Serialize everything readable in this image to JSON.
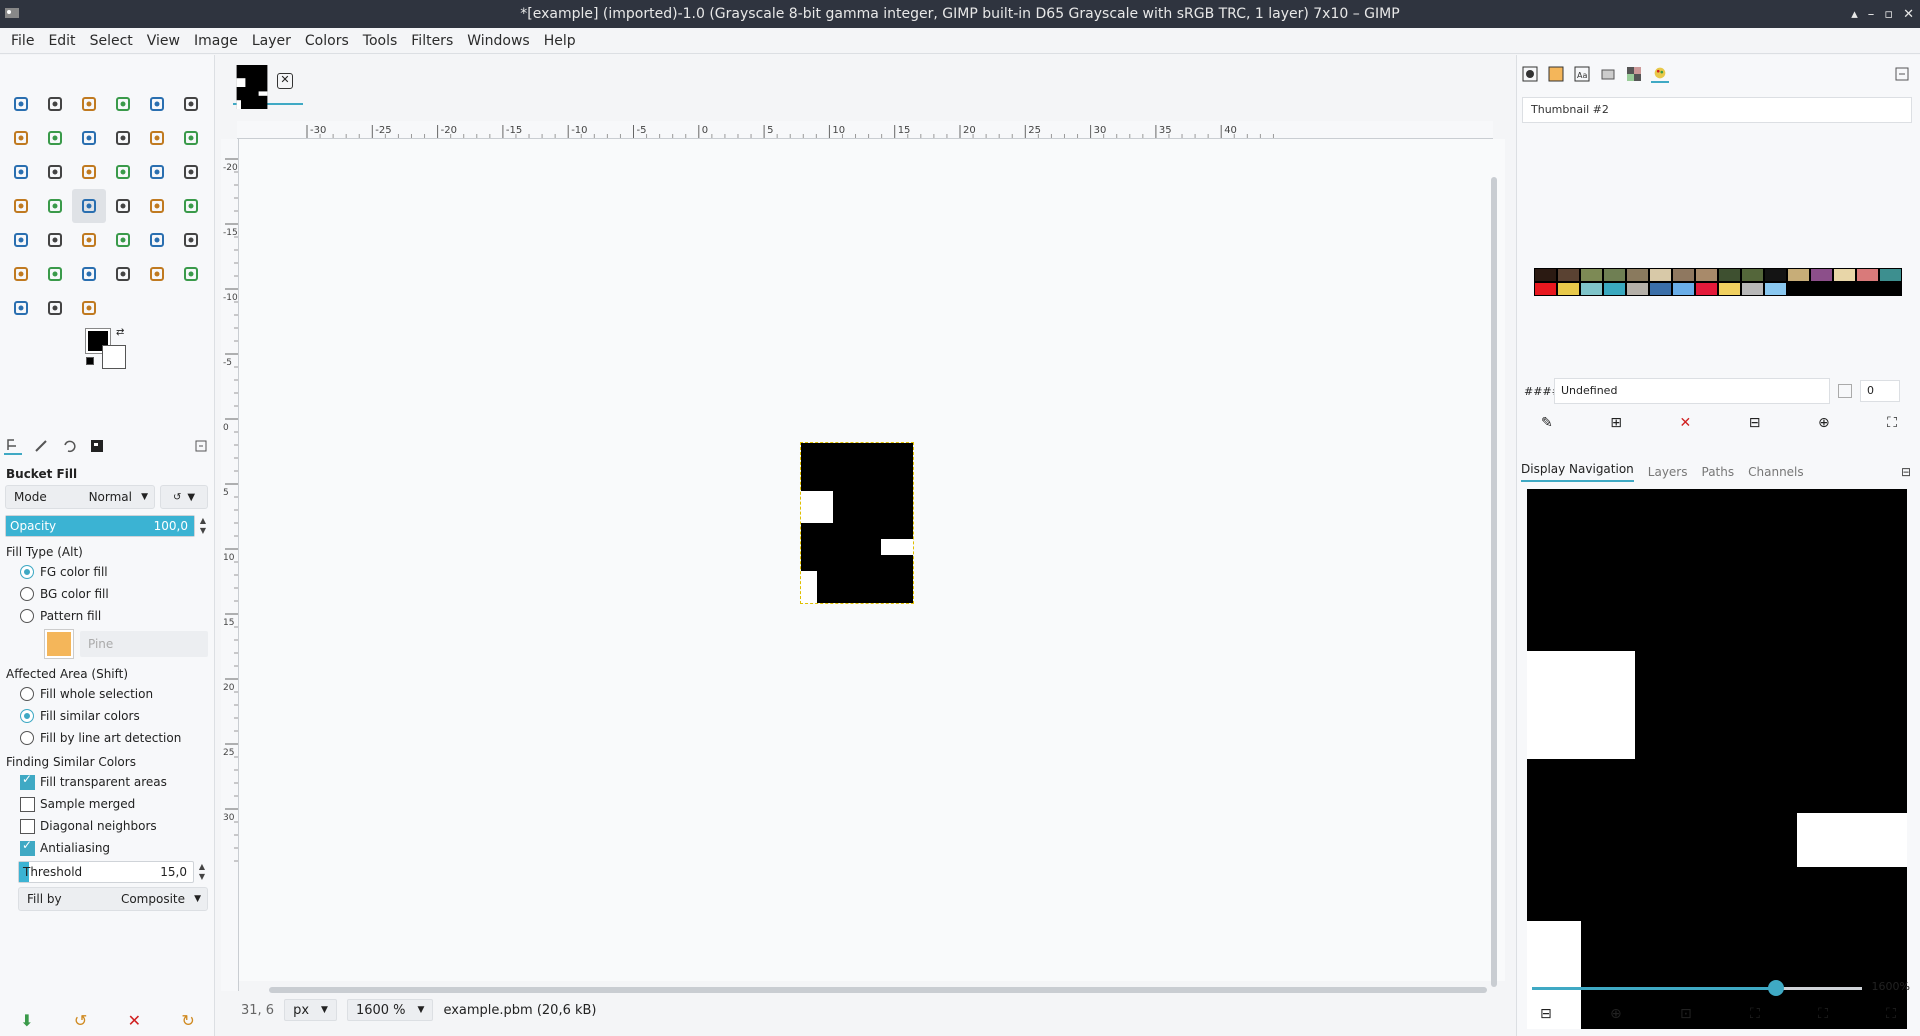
{
  "window": {
    "title": "*[example] (imported)-1.0 (Grayscale 8-bit gamma integer, GIMP built-in D65 Grayscale with sRGB TRC, 1 layer) 7x10 – GIMP",
    "controls": [
      "▴",
      "–",
      "▫",
      "✕"
    ]
  },
  "menu": [
    "File",
    "Edit",
    "Select",
    "View",
    "Image",
    "Layer",
    "Colors",
    "Tools",
    "Filters",
    "Windows",
    "Help"
  ],
  "tools": [
    "move-tool",
    "align-tool",
    "rect-select-tool",
    "ellipse-select-tool",
    "free-select-tool",
    "scissors-select-tool",
    "foreground-select-tool",
    "fuzzy-select-tool",
    "color-select-tool",
    "crop-tool",
    "unified-transform-tool",
    "warp-tool",
    "rotate-tool",
    "scale-tool",
    "shear-tool",
    "perspective-tool",
    "3d-transform-tool",
    "handle-transform-tool",
    "flip-tool",
    "cage-tool",
    "bucket-fill-tool",
    "gradient-tool",
    "paintbrush-tool",
    "pencil-tool",
    "airbrush-tool",
    "ink-tool",
    "mypaint-brush-tool",
    "eraser-tool",
    "clone-tool",
    "heal-tool",
    "smudge-tool",
    "convolve-tool",
    "dodge-burn-tool",
    "text-tool-alt",
    "paths-tool",
    "text-tool",
    "color-picker-tool",
    "measure-tool",
    "zoom-tool"
  ],
  "tool_options": {
    "title": "Bucket Fill",
    "mode_label": "Mode",
    "mode_value": "Normal",
    "opacity_label": "Opacity",
    "opacity_value": "100,0",
    "opacity_fraction": 1.0,
    "fill_type_label": "Fill Type  (Alt)",
    "fill_types": [
      "FG color fill",
      "BG color fill",
      "Pattern fill"
    ],
    "fill_type_selected": 0,
    "pattern_name": "Pine",
    "affected_label": "Affected Area  (Shift)",
    "affected_options": [
      "Fill whole selection",
      "Fill similar colors",
      "Fill by line art detection"
    ],
    "affected_selected": 1,
    "finding_label": "Finding Similar Colors",
    "checks": [
      {
        "label": "Fill transparent areas",
        "checked": true
      },
      {
        "label": "Sample merged",
        "checked": false
      },
      {
        "label": "Diagonal neighbors",
        "checked": false
      },
      {
        "label": "Antialiasing",
        "checked": true
      }
    ],
    "threshold_label": "Threshold",
    "threshold_value": "15,0",
    "threshold_fraction": 0.06,
    "fillby_label": "Fill by",
    "fillby_value": "Composite"
  },
  "ruler_h_labels": [
    "-30",
    "-25",
    "-20",
    "-15",
    "-10",
    "-5",
    "0",
    "5",
    "10",
    "15",
    "20",
    "25",
    "30",
    "35",
    "40"
  ],
  "ruler_v_labels": [
    "-20",
    "-15",
    "-10",
    "-5",
    "0",
    "5",
    "10",
    "15",
    "20",
    "25",
    "30"
  ],
  "status": {
    "coords": "31, 6",
    "unit": "px",
    "zoom": "1600 %",
    "file": "example.pbm (20,6 kB)"
  },
  "palette_panel": {
    "name": "Thumbnail #2",
    "hash_label": "####",
    "color_name": "Undefined",
    "columns_value": "0",
    "colors": [
      "#2b1a12",
      "#5a4232",
      "#7d8a55",
      "#6f7f53",
      "#8a7a5e",
      "#d8c9a8",
      "#8f7860",
      "#a88a6a",
      "#3e5030",
      "#54663a",
      "#141414",
      "#c7ad78",
      "#8c4f8a",
      "#e8d6a8",
      "#d97a7a",
      "#3d8f8f",
      "#e8181f",
      "#e8c94a",
      "#7fc4c9",
      "#3aa9bf",
      "#b5b0a8",
      "#3b6fa8",
      "#6aaee8",
      "#e41a3a",
      "#f0d060",
      "#b8b8b8",
      "#8ac8f0",
      "#000000",
      "#000000",
      "#000000",
      "#000000",
      "#000000"
    ]
  },
  "nav_panel": {
    "tabs": [
      "Display Navigation",
      "Layers",
      "Paths",
      "Channels"
    ],
    "zoom_label": "1600%",
    "zoom_fraction": 0.74
  }
}
